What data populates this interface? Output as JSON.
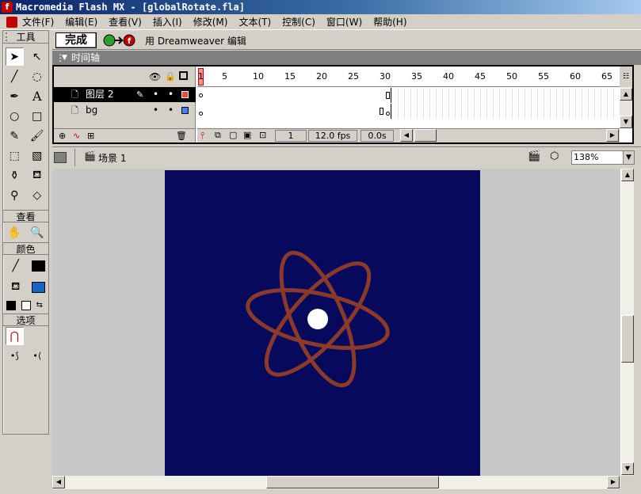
{
  "window": {
    "title": "Macromedia Flash MX - [globalRotate.fla]"
  },
  "menu": [
    "文件(F)",
    "编辑(E)",
    "查看(V)",
    "插入(I)",
    "修改(M)",
    "文本(T)",
    "控制(C)",
    "窗口(W)",
    "帮助(H)"
  ],
  "tools_panel": {
    "title": "工具",
    "view_section": "查看",
    "colors_section": "颜色",
    "options_section": "选项",
    "stroke_color": "#000000",
    "fill_color": "#1464c8"
  },
  "edit_bar": {
    "done_label": "完成",
    "edit_with_label": "用 Dreamweaver 编辑"
  },
  "timeline": {
    "title": "时间轴",
    "ruler": [
      "1",
      "5",
      "10",
      "15",
      "20",
      "25",
      "30",
      "35",
      "40",
      "45",
      "50",
      "55",
      "60",
      "65"
    ],
    "layers": [
      {
        "name": "图层 2",
        "selected": true,
        "color": "#ff4040"
      },
      {
        "name": "bg",
        "selected": false,
        "color": "#4080ff"
      }
    ],
    "current_frame": "1",
    "frame_rate": "12.0 fps",
    "elapsed": "0.0s"
  },
  "scene": {
    "label": "场景 1",
    "zoom": "138%"
  },
  "stage": {
    "background": "#070a5c",
    "orbit_color": "#8b3a2a",
    "nucleus_color": "#ffffff"
  }
}
